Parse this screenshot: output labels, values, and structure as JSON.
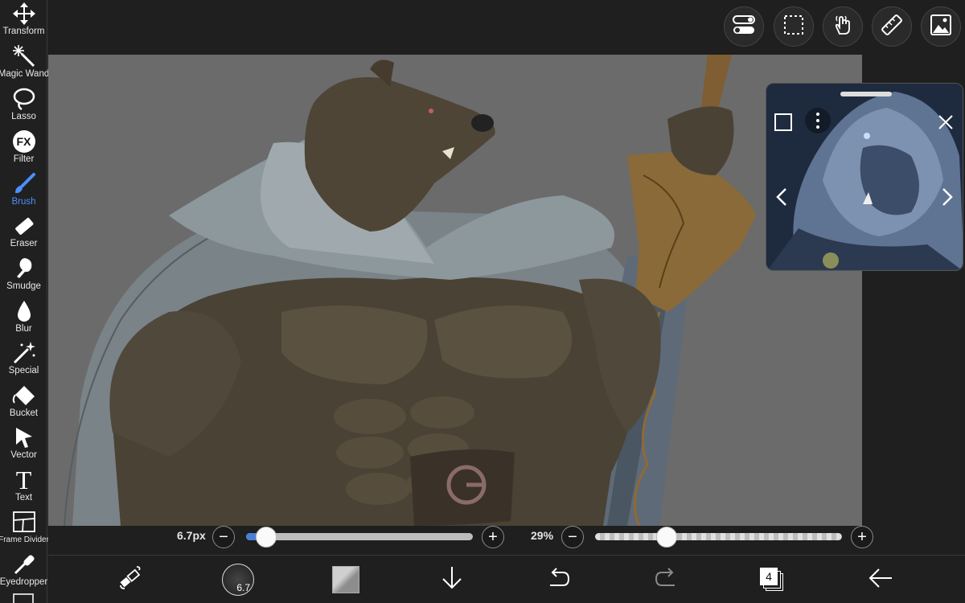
{
  "toolbar": {
    "items": [
      {
        "label": "Transform",
        "icon": "transform-arrows-icon"
      },
      {
        "label": "Magic Wand",
        "icon": "magic-wand-icon"
      },
      {
        "label": "Lasso",
        "icon": "lasso-icon"
      },
      {
        "label": "Filter",
        "icon": "fx-filter-icon"
      },
      {
        "label": "Brush",
        "icon": "brush-icon",
        "active": true
      },
      {
        "label": "Eraser",
        "icon": "eraser-icon"
      },
      {
        "label": "Smudge",
        "icon": "smudge-icon"
      },
      {
        "label": "Blur",
        "icon": "blur-drop-icon"
      },
      {
        "label": "Special",
        "icon": "special-sparkle-icon"
      },
      {
        "label": "Bucket",
        "icon": "bucket-icon"
      },
      {
        "label": "Vector",
        "icon": "vector-cursor-icon"
      },
      {
        "label": "Text",
        "icon": "text-icon"
      },
      {
        "label": "Frame Divider",
        "icon": "frame-divider-icon"
      },
      {
        "label": "Eyedropper",
        "icon": "eyedropper-icon"
      }
    ],
    "filter_glyph": "FX",
    "text_glyph": "T",
    "active_color": "#4a90ff"
  },
  "topbar": {
    "buttons": [
      "toggle-icon",
      "selection-icon",
      "hand-touch-icon",
      "ruler-icon",
      "reference-image-icon"
    ]
  },
  "reference": {
    "icons": [
      "square-icon",
      "more-vertical-icon",
      "close-icon",
      "chevron-left-icon",
      "chevron-right-icon"
    ]
  },
  "sliders": {
    "brush_size_label": "6.7px",
    "brush_size_fraction": 0.09,
    "opacity_label": "29%",
    "opacity_fraction": 0.29,
    "minus_glyph": "−",
    "plus_glyph": "+",
    "fill_color": "#4a7fd6"
  },
  "bottombar": {
    "brush_size_value": "6.7",
    "layer_count": "4",
    "buttons": [
      "swap-colors-icon",
      "brush-size-icon",
      "color-swatch-icon",
      "download-icon",
      "undo-icon",
      "redo-icon",
      "layers-icon",
      "back-arrow-icon"
    ]
  }
}
